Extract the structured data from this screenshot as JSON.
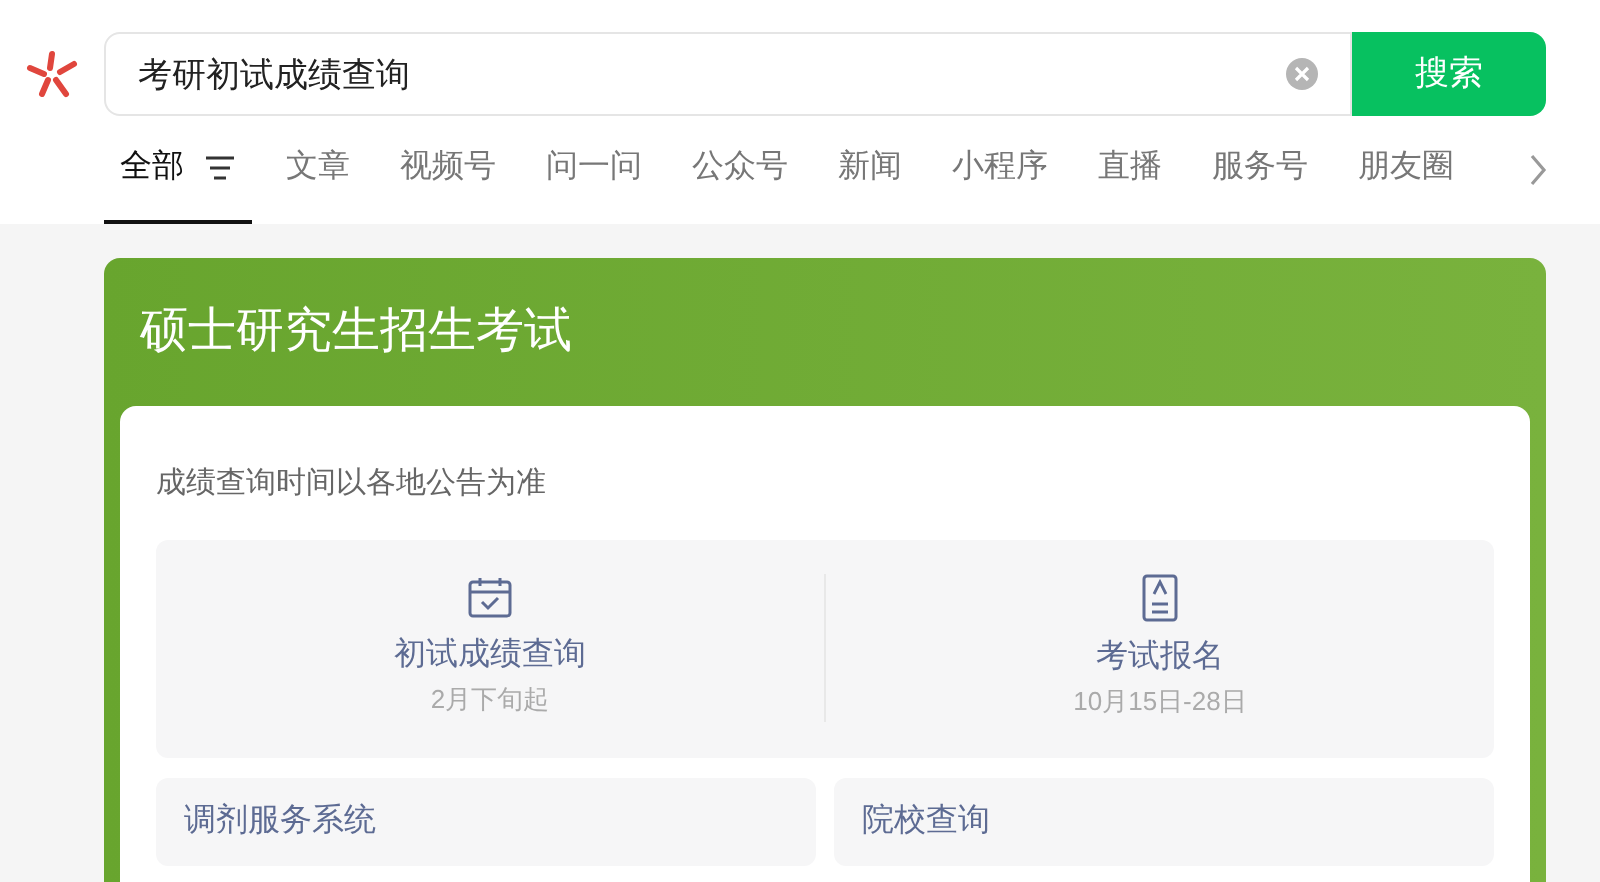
{
  "search": {
    "value": "考研初试成绩查询",
    "button": "搜索"
  },
  "tabs": [
    {
      "label": "全部",
      "selected": true
    },
    {
      "label": "文章",
      "selected": false
    },
    {
      "label": "视频号",
      "selected": false
    },
    {
      "label": "问一问",
      "selected": false
    },
    {
      "label": "公众号",
      "selected": false
    },
    {
      "label": "新闻",
      "selected": false
    },
    {
      "label": "小程序",
      "selected": false
    },
    {
      "label": "直播",
      "selected": false
    },
    {
      "label": "服务号",
      "selected": false
    },
    {
      "label": "朋友圈",
      "selected": false
    }
  ],
  "card": {
    "title": "硕士研究生招生考试",
    "note": "成绩查询时间以各地公告为准",
    "features": [
      {
        "kind": "calendar",
        "label": "初试成绩查询",
        "sub": "2月下旬起"
      },
      {
        "kind": "document",
        "label": "考试报名",
        "sub": "10月15日-28日"
      }
    ],
    "links": [
      "调剂服务系统",
      "院校查询"
    ]
  }
}
